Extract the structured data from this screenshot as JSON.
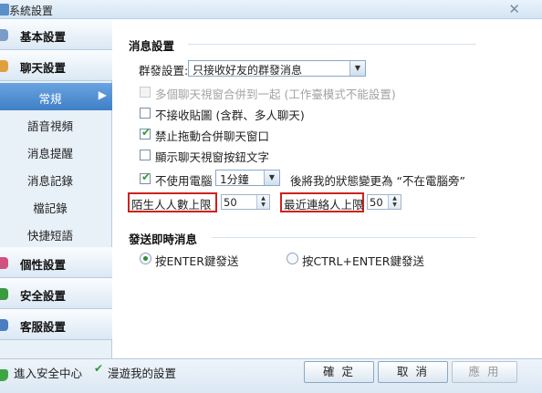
{
  "window": {
    "title": "系統設置",
    "close_glyph": "✕"
  },
  "sidebar": {
    "categories": [
      {
        "label": "基本設置",
        "icon": "settings-icon",
        "color": "#7a9cc8"
      },
      {
        "label": "聊天設置",
        "icon": "chat-icon",
        "color": "#e0a040"
      },
      {
        "label": "個性設置",
        "icon": "personalize-icon",
        "color": "#d05080"
      },
      {
        "label": "安全設置",
        "icon": "shield-icon",
        "color": "#3a9a40"
      },
      {
        "label": "客服設置",
        "icon": "service-icon",
        "color": "#4a7ec0"
      }
    ],
    "chat_items": [
      "常規",
      "語音視頻",
      "消息提醒",
      "消息記錄",
      "檔記錄",
      "快捷短語"
    ],
    "active_item": "常規",
    "arrow": "▶"
  },
  "message_settings": {
    "title": "消息設置",
    "group_label": "群發設置:",
    "group_value": "只接收好友的群發消息",
    "options": [
      {
        "label": "多個聊天視窗合併到一起 (工作臺模式不能設置)",
        "checked": false,
        "disabled": true
      },
      {
        "label": "不接收貼圖 (含群、多人聊天)",
        "checked": false,
        "disabled": false
      },
      {
        "label": "禁止拖動合併聊天窗口",
        "checked": true,
        "disabled": false
      },
      {
        "label": "顯示聊天視窗按鈕文字",
        "checked": false,
        "disabled": false
      }
    ],
    "idle": {
      "label": "不使用電腦",
      "checked": true,
      "value": "1分鐘",
      "suffix": "後將我的狀態變更為 “不在電腦旁”"
    },
    "stranger_limit": {
      "label": "陌生人人數上限",
      "value": "50"
    },
    "recent_limit": {
      "label": "最近連絡人上限",
      "value": "50"
    }
  },
  "send_settings": {
    "title": "發送即時消息",
    "options": [
      {
        "label": "按ENTER鍵發送",
        "selected": true
      },
      {
        "label": "按CTRL+ENTER鍵發送",
        "selected": false
      }
    ]
  },
  "footer": {
    "security_center": "進入安全中心",
    "roaming": {
      "label": "漫遊我的設置",
      "checked": true
    },
    "ok": "確 定",
    "cancel": "取 消",
    "apply": "應 用"
  },
  "colors": {
    "accent": "#3f7fc6",
    "highlight_border": "#d0201d",
    "check": "#2b9b38"
  }
}
